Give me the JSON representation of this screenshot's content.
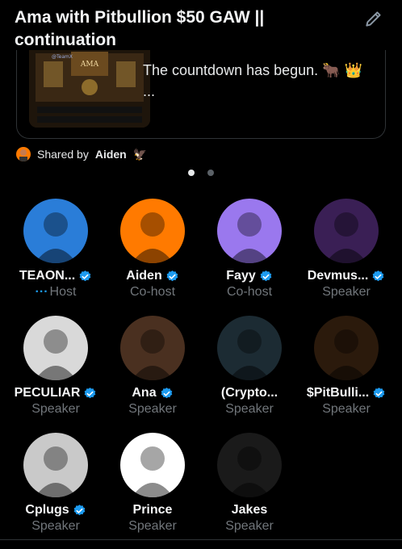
{
  "header": {
    "title": "Ama with Pitbullion $50 GAW || continuation"
  },
  "card": {
    "text": "The countdown has begun. 🐂 👑 ...",
    "thumb_label": "AMA",
    "thumb_tag": "@TeamX"
  },
  "shared": {
    "prefix": "Shared by",
    "name": "Aiden",
    "emoji": "🦅"
  },
  "pager": {
    "count": 2,
    "active": 0
  },
  "participants": [
    {
      "name": "TEAON...",
      "role": "Host",
      "verified": true,
      "avatar": "avatar-teaon",
      "bg": "#2a7dd8"
    },
    {
      "name": "Aiden",
      "role": "Co-host",
      "verified": true,
      "avatar": "avatar-aiden",
      "bg": "#ff7a00"
    },
    {
      "name": "Fayy",
      "role": "Co-host",
      "verified": true,
      "avatar": "avatar-fayy",
      "bg": "#9a78ee"
    },
    {
      "name": "Devmus...",
      "role": "Speaker",
      "verified": true,
      "avatar": "avatar-devmus",
      "bg": "#3a1f55"
    },
    {
      "name": "PECULIAR",
      "role": "Speaker",
      "verified": true,
      "avatar": "avatar-peculiar",
      "bg": "#d9d9d9"
    },
    {
      "name": "Ana",
      "role": "Speaker",
      "verified": true,
      "avatar": "avatar-ana",
      "bg": "#4a3020"
    },
    {
      "name": "(Crypto...",
      "role": "Speaker",
      "verified": false,
      "avatar": "avatar-crypto",
      "bg": "#1c2b33"
    },
    {
      "name": "$PitBulli...",
      "role": "Speaker",
      "verified": true,
      "avatar": "avatar-pitbull",
      "bg": "#2b1a0c"
    },
    {
      "name": "Cplugs",
      "role": "Speaker",
      "verified": true,
      "avatar": "avatar-cplugs",
      "bg": "#c9c9c9"
    },
    {
      "name": "Prince",
      "role": "Speaker",
      "verified": false,
      "avatar": "avatar-prince",
      "bg": "#ffffff"
    },
    {
      "name": "Jakes",
      "role": "Speaker",
      "verified": false,
      "avatar": "avatar-jakes",
      "bg": "#1a1a1a"
    }
  ],
  "colors": {
    "accent": "#1d9bf0",
    "muted": "#71767b",
    "bg": "#000000"
  }
}
